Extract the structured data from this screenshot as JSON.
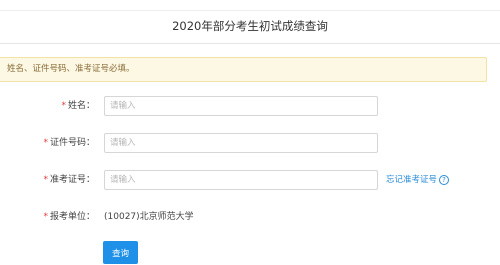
{
  "page": {
    "title": "2020年部分考生初试成绩查询"
  },
  "notice": {
    "text": "姓名、证件号码、准考证号必填。"
  },
  "form": {
    "required_mark": "*",
    "name": {
      "label": "姓名：",
      "placeholder": "请输入",
      "value": ""
    },
    "id_number": {
      "label": "证件号码：",
      "placeholder": "请输入",
      "value": ""
    },
    "exam_number": {
      "label": "准考证号：",
      "placeholder": "请输入",
      "value": "",
      "forgot_link": "忘记准考证号",
      "help_icon_glyph": "?"
    },
    "unit": {
      "label": "报考单位：",
      "value": "(10027)北京师范大学"
    },
    "submit_label": "查询"
  }
}
